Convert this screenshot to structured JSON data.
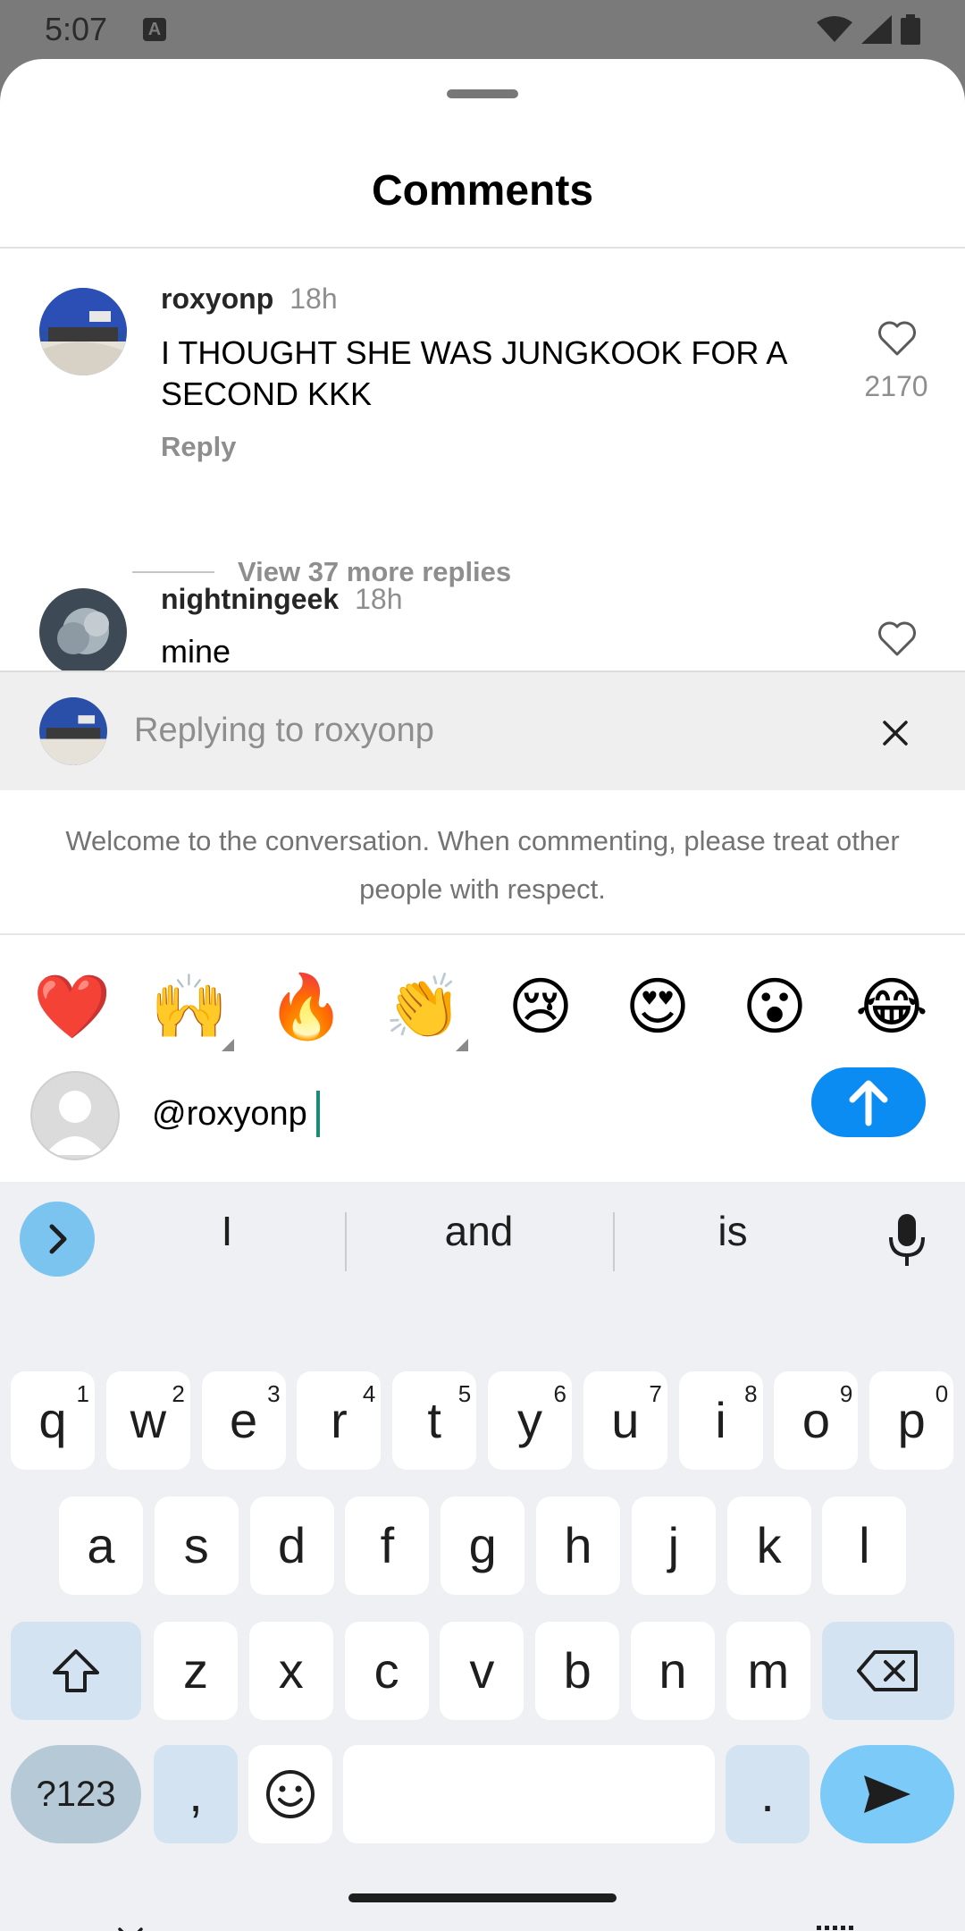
{
  "status_bar": {
    "time": "5:07",
    "notification_icon": "A"
  },
  "sheet": {
    "title": "Comments"
  },
  "comments": [
    {
      "user": "roxyonp",
      "time": "18h",
      "text": "I THOUGHT SHE WAS JUNGKOOK FOR A SECOND KKK",
      "reply_label": "Reply",
      "likes": "2170",
      "more_replies": "View 37 more replies"
    },
    {
      "user": "nightningeek",
      "time": "18h",
      "text": "mine"
    }
  ],
  "replying": {
    "label": "Replying to roxyonp"
  },
  "welcome": {
    "text": "Welcome to the conversation. When commenting, please treat other people with respect."
  },
  "emoji_bar": {
    "items": [
      {
        "glyph": "❤️",
        "name": "red-heart"
      },
      {
        "glyph": "🙌",
        "name": "raising-hands"
      },
      {
        "glyph": "🔥",
        "name": "fire"
      },
      {
        "glyph": "👏",
        "name": "clapping-hands"
      },
      {
        "glyph": "😢",
        "name": "crying-face"
      },
      {
        "glyph": "😍",
        "name": "heart-eyes"
      },
      {
        "glyph": "😮",
        "name": "surprised-face"
      },
      {
        "glyph": "😂",
        "name": "tears-of-joy"
      }
    ]
  },
  "composer": {
    "value": "@roxyonp"
  },
  "keyboard": {
    "suggestions": [
      "I",
      "and",
      "is"
    ],
    "row1": [
      {
        "k": "q",
        "n": "1"
      },
      {
        "k": "w",
        "n": "2"
      },
      {
        "k": "e",
        "n": "3"
      },
      {
        "k": "r",
        "n": "4"
      },
      {
        "k": "t",
        "n": "5"
      },
      {
        "k": "y",
        "n": "6"
      },
      {
        "k": "u",
        "n": "7"
      },
      {
        "k": "i",
        "n": "8"
      },
      {
        "k": "o",
        "n": "9"
      },
      {
        "k": "p",
        "n": "0"
      }
    ],
    "row2": [
      "a",
      "s",
      "d",
      "f",
      "g",
      "h",
      "j",
      "k",
      "l"
    ],
    "row3": [
      "z",
      "x",
      "c",
      "v",
      "b",
      "n",
      "m"
    ],
    "symbols_label": "?123",
    "comma": ",",
    "period": "."
  },
  "colors": {
    "accent_blue": "#0b8cf2",
    "sheet_bg": "#ffffff",
    "muted_text": "#8e8e8e"
  }
}
